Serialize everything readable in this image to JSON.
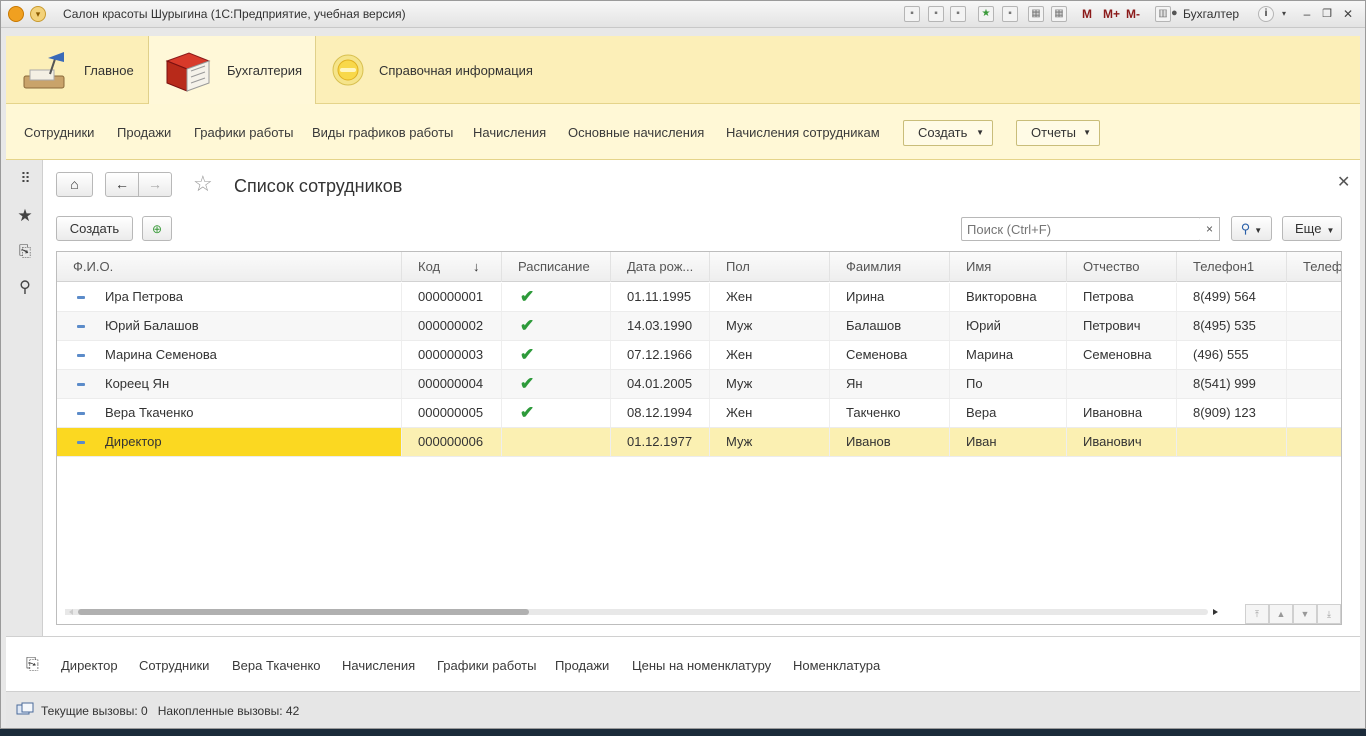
{
  "window": {
    "title": "Салон красоты Шурыгина  (1С:Предприятие, учебная версия)",
    "user": "Бухгалтер",
    "toolbar_labels": [
      "M",
      "M+",
      "M-"
    ]
  },
  "sections": [
    {
      "label": "Главное",
      "icon": "desk-lamp-icon"
    },
    {
      "label": "Бухгалтерия",
      "icon": "ledger-book-icon"
    },
    {
      "label": "Справочная информация",
      "icon": "info-disc-icon"
    }
  ],
  "nav": {
    "links": [
      "Сотрудники",
      "Продажи",
      "Графики работы",
      "Виды графиков работы",
      "Начисления",
      "Основные начисления",
      "Начисления сотрудникам"
    ],
    "create_label": "Создать",
    "reports_label": "Отчеты"
  },
  "form": {
    "title": "Список сотрудников",
    "create_button": "Создать",
    "search_placeholder": "Поиск (Ctrl+F)",
    "more_button": "Еще"
  },
  "table": {
    "columns": [
      "Ф.И.О.",
      "Код",
      "Расписание",
      "Дата рож...",
      "Пол",
      "Фаимлия",
      "Имя",
      "Отчество",
      "Телефон1",
      "Телефо"
    ],
    "sort_indicator": "↓",
    "rows": [
      {
        "fio": "Ира Петрова",
        "code": "000000001",
        "schedule": true,
        "birth": "01.11.1995",
        "gender": "Жен",
        "surname": "Ирина",
        "name": "Викторовна",
        "patronymic": "Петрова",
        "phone1": "8(499) 564",
        "phone2": ""
      },
      {
        "fio": "Юрий Балашов",
        "code": "000000002",
        "schedule": true,
        "birth": "14.03.1990",
        "gender": "Муж",
        "surname": "Балашов",
        "name": "Юрий",
        "patronymic": "Петрович",
        "phone1": "8(495) 535",
        "phone2": ""
      },
      {
        "fio": "Марина Семенова",
        "code": "000000003",
        "schedule": true,
        "birth": "07.12.1966",
        "gender": "Жен",
        "surname": "Семенова",
        "name": "Марина",
        "patronymic": "Семеновна",
        "phone1": " (496) 555",
        "phone2": ""
      },
      {
        "fio": "Кореец Ян",
        "code": "000000004",
        "schedule": true,
        "birth": "04.01.2005",
        "gender": "Муж",
        "surname": "Ян",
        "name": "По",
        "patronymic": "",
        "phone1": "8(541) 999",
        "phone2": ""
      },
      {
        "fio": "Вера Ткаченко",
        "code": "000000005",
        "schedule": true,
        "birth": "08.12.1994",
        "gender": "Жен",
        "surname": "Такченко",
        "name": "Вера",
        "patronymic": "Ивановна",
        "phone1": "8(909) 123",
        "phone2": ""
      },
      {
        "fio": "Директор",
        "code": "000000006",
        "schedule": false,
        "birth": "01.12.1977",
        "gender": "Муж",
        "surname": "Иванов",
        "name": "Иван",
        "patronymic": "Иванович",
        "phone1": "",
        "phone2": ""
      }
    ],
    "selected_row": 5,
    "horizontal_scroll_fraction": 0.39
  },
  "bottom_links": [
    "Директор",
    "Сотрудники",
    "Вера Ткаченко",
    "Начисления",
    "Графики работы",
    "Продажи",
    "Цены на номенклатуру",
    "Номенклатура"
  ],
  "status": {
    "current_calls_label": "Текущие вызовы:",
    "current_calls": "0",
    "accumulated_calls_label": "Накопленные вызовы:",
    "accumulated_calls": "42"
  },
  "colors": {
    "sections_bg": "#fcefb8",
    "nav_bg": "#fff8d6",
    "selected_row": "#fbf0b2",
    "selected_cell": "#fbd821",
    "check": "#2d9a3a"
  }
}
